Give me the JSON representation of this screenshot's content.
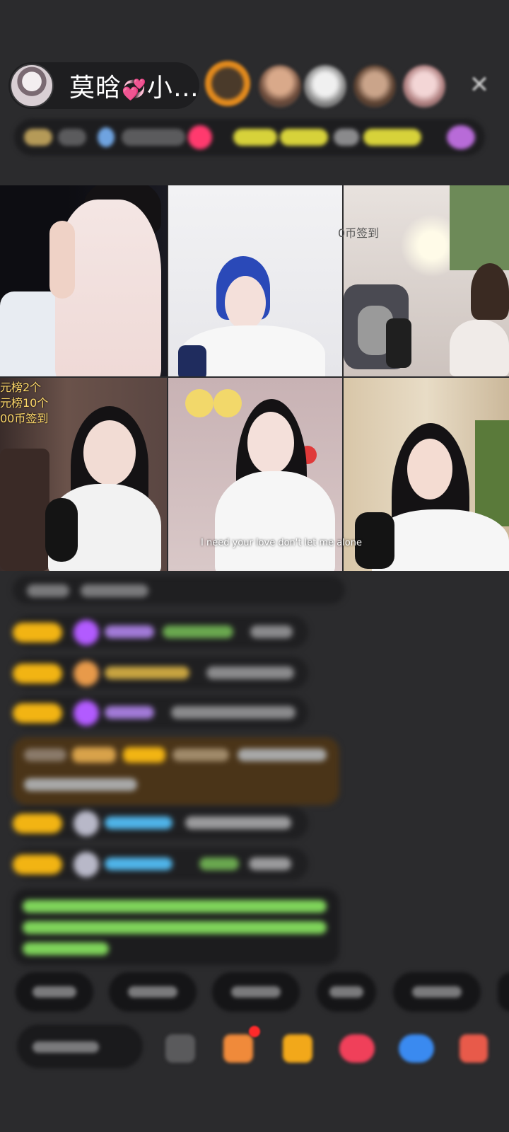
{
  "header": {
    "host_name": "莫晗",
    "host_name_heart": "💞",
    "host_name_tail": "小…",
    "close_symbol": "✕"
  },
  "grid": {
    "overlay_rank_lines": [
      "元榜2个",
      "元榜10个",
      "00币签到"
    ],
    "sign_in_text": "0币签到",
    "caption": "I need your love don't let me alone"
  },
  "colors": {
    "background": "#2b2b2d",
    "badge_gold": "#f2b413",
    "accent_purple": "#b25bff",
    "chat_green": "#7fd45a",
    "chat_blue": "#4fb3e8"
  }
}
